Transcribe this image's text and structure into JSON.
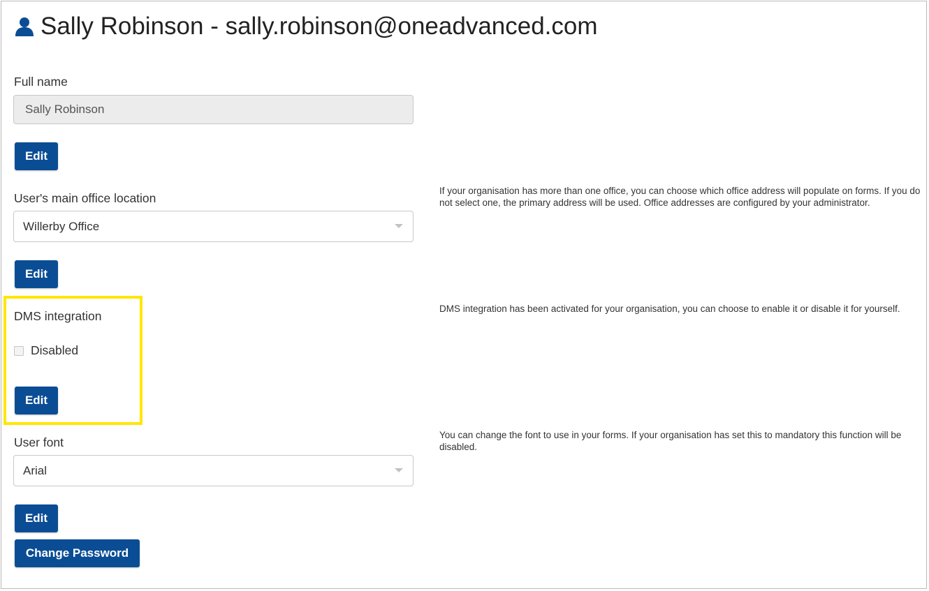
{
  "header": {
    "title": "Sally Robinson - sally.robinson@oneadvanced.com",
    "icon": "user-icon",
    "icon_color": "#0b4d95"
  },
  "full_name": {
    "label": "Full name",
    "value": "Sally Robinson",
    "edit_label": "Edit"
  },
  "office": {
    "label": "User's main office location",
    "value": "Willerby Office",
    "edit_label": "Edit",
    "help": "If your organisation has more than one office, you can choose which office address will populate on forms. If you do not select one, the primary address will be used. Office addresses are configured by your administrator."
  },
  "dms": {
    "label": "DMS integration",
    "checkbox_label": "Disabled",
    "checked": false,
    "edit_label": "Edit",
    "help": "DMS integration has been activated for your organisation, you can choose to enable it or disable it for yourself.",
    "highlight_color": "#ffe600"
  },
  "font": {
    "label": "User font",
    "value": "Arial",
    "edit_label": "Edit",
    "help": "You can change the font to use in your forms. If your organisation has set this to mandatory this function will be disabled."
  },
  "change_password_label": "Change Password",
  "colors": {
    "button": "#0b4d95",
    "highlight": "#ffe600"
  }
}
